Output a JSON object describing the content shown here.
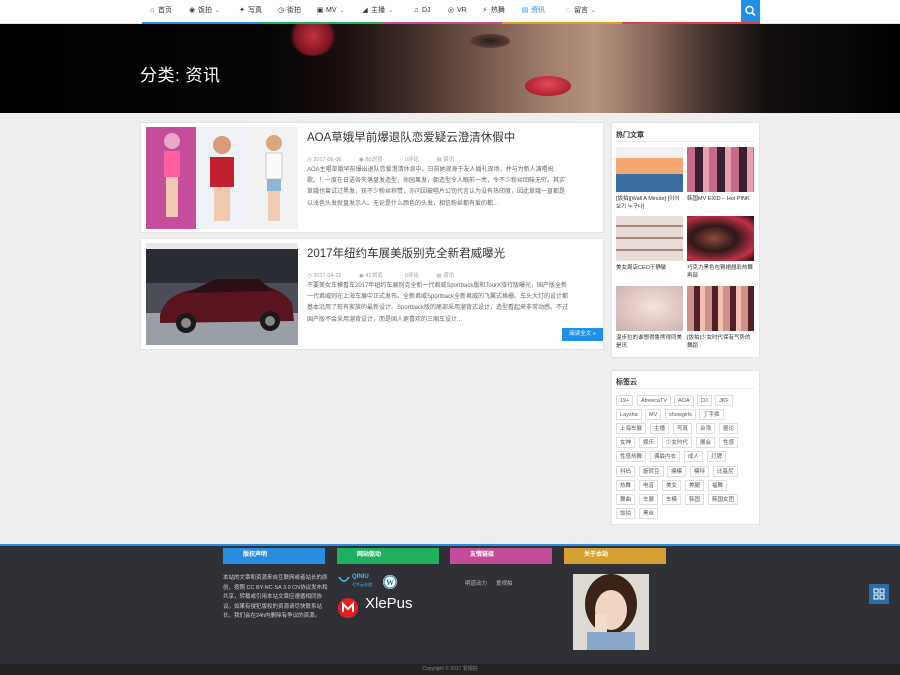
{
  "nav": {
    "items": [
      {
        "label": "首页",
        "icon": "home-icon"
      },
      {
        "label": "饭拍",
        "icon": "camera-icon",
        "dropdown": true
      },
      {
        "label": "写真",
        "icon": "pin-icon"
      },
      {
        "label": "街拍",
        "icon": "clock-icon"
      },
      {
        "label": "MV",
        "icon": "video-icon",
        "dropdown": true
      },
      {
        "label": "主播",
        "icon": "anchor-icon",
        "dropdown": true
      },
      {
        "label": "DJ",
        "icon": "music-icon"
      },
      {
        "label": "VR",
        "icon": "eye-icon"
      },
      {
        "label": "热舞",
        "icon": "dance-icon"
      },
      {
        "label": "资讯",
        "icon": "news-icon",
        "active": true
      },
      {
        "label": "留言",
        "icon": "comment-icon",
        "dropdown": true
      }
    ],
    "stripe_colors": [
      "#2a8ee0",
      "#20b060",
      "#c24c9a",
      "#e0a020",
      "#e04040"
    ]
  },
  "hero": {
    "title": "分类: 资讯"
  },
  "posts": [
    {
      "title": "AOA草娥早前爆退队恋爱疑云澄清休假中",
      "date": "2017-06-06",
      "views": "80浏览",
      "comments": "0评论",
      "category": "资讯",
      "excerpt": "AOA主唱草娥早前爆出退队恋爱澄清休息中。日前她现身于友人婚礼现场，并与为新人演唱祝歌。！一度在日语各失落盘发造型，命园果发，朝造型令人眼前一亮，令不少粉丝回味无穷。其实草娥也曾试过黑发，获不少粉丝称赞，亦问因被唱片公司代言认为没有热印度，因此草娥一直都是以浅色头发就盘发示人。无论是什么颜色的头发，相信粉丝都有爱的都..."
    },
    {
      "title": "2017年纽约车展美版别克全新君威曝光",
      "date": "2017-04-22",
      "views": "41浏览",
      "comments": "0评论",
      "category": "资讯",
      "excerpt": "不要美女车模看车2017年纽约车展别克全新一代君威Sportback版和TourX旅行版曝光，国产版全新一代君威则在上海车展中正式发布。全新君威Sportback全新君威的飞翼式格栅、车头大灯的设计都基本沿用了现有家族的最新设计。Sportback版的尾部采用溜背式设计，造型看起来非常动感。不过国产版不会采用溜背设计，而是国人更喜欢的三厢车设计...",
      "readmore": "阅读全文 »"
    }
  ],
  "sidebar": {
    "hot_title": "热门文章",
    "hot_posts": [
      {
        "caption": "[饭拍][Wall A Minute] [이어보기 누구나]"
      },
      {
        "caption": "韩国MV EXID – Hot PINK"
      },
      {
        "caption": "美女周店CEO干静敏"
      },
      {
        "caption": "巧克力黑色包臀裙翘彩热舞再部"
      },
      {
        "caption": "温步拉的谁想得鲁熊得同美是讯"
      },
      {
        "caption": "[饭拍]少女时代保有气势的舞蹈"
      }
    ],
    "tag_title": "标签云",
    "tags": [
      [
        "19+",
        "AfreecaTV",
        "AOA",
        "DJ",
        "JKF"
      ],
      [
        "Laysha",
        "MV",
        "showgirls",
        "丁字裤"
      ],
      [
        "上海车展",
        "主播",
        "写真",
        "台湾",
        "屋论"
      ],
      [
        "女神",
        "娱乐",
        "少女时代",
        "展会",
        "性感"
      ],
      [
        "性感热舞",
        "偶最内衣",
        "成人",
        "打牌"
      ],
      [
        "抖码",
        "旋转豆",
        "摸模",
        "模特",
        "比基尼"
      ],
      [
        "热舞",
        "电音",
        "美女",
        "美腿",
        "福舞"
      ],
      [
        "舞曲",
        "车展",
        "车模",
        "韩国",
        "韩国女团"
      ],
      [
        "饭拍",
        "黑丝"
      ]
    ]
  },
  "footer": {
    "headings": [
      {
        "label": "版权声明",
        "color": "#2a8ee0"
      },
      {
        "label": "网站驱动",
        "color": "#20b060"
      },
      {
        "label": "友情链接",
        "color": "#c24c9a"
      },
      {
        "label": "关于本站",
        "color": "#d4a030"
      }
    ],
    "copyright_text": "本站的文章和资源来自互联网或者站长的原创，按照 CC BY-NC-SA 3.0 CN协议发布和共享，转载或引用本站文章应遵循相同协议。如果有侵犯版权的资源请尽快联系站长，我们会在24h内删除有争议的资源。",
    "brands": {
      "qiniu": "QINIU",
      "qiniu_sub": "七牛云存储",
      "xlepus": "XlePus"
    },
    "links": [
      "明道动力",
      "爱视拍"
    ],
    "copyright": "Copyright © 2017 爱视拍"
  }
}
